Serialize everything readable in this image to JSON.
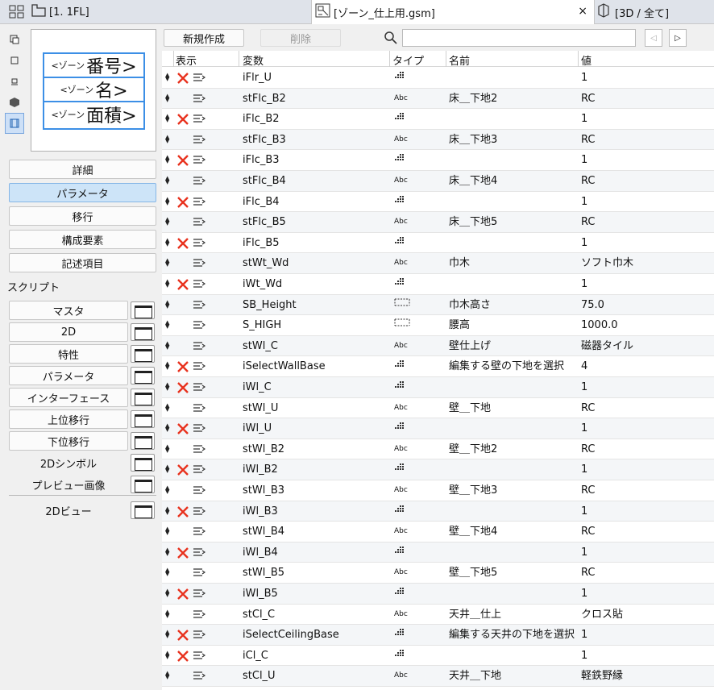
{
  "tabs": {
    "floor_label": "[1. 1FL]",
    "object_label": "[ゾーン_仕上用.gsm]",
    "view3d_label": "[3D / 全て]",
    "close_glyph": "×"
  },
  "preview": {
    "line1_prefix": "<ゾーン",
    "line1_text": "番号>",
    "line2_prefix": "<ゾーン",
    "line2_text": "名>",
    "line3_prefix": "<ゾーン",
    "line3_text": "面積>"
  },
  "nav": [
    "詳細",
    "パラメータ",
    "移行",
    "構成要素",
    "記述項目"
  ],
  "nav_selected": 1,
  "scripts_label": "スクリプト",
  "scripts": [
    "マスタ",
    "2D",
    "特性",
    "パラメータ",
    "インターフェース",
    "上位移行",
    "下位移行",
    "2Dシンボル",
    "プレビュー画像"
  ],
  "view2d_label": "2Dビュー",
  "toolbar": {
    "new_label": "新規作成",
    "delete_label": "削除",
    "search_placeholder": ""
  },
  "columns": {
    "display": "表示",
    "variable": "変数",
    "type": "タイプ",
    "name": "名前",
    "value": "値"
  },
  "rows": [
    {
      "hidden": true,
      "var": "iFlr_U",
      "type": "int",
      "name": "",
      "value": "1"
    },
    {
      "hidden": false,
      "var": "stFlc_B2",
      "type": "abc",
      "name": "床＿下地2",
      "value": "RC"
    },
    {
      "hidden": true,
      "var": "iFlc_B2",
      "type": "int",
      "name": "",
      "value": "1"
    },
    {
      "hidden": false,
      "var": "stFlc_B3",
      "type": "abc",
      "name": "床＿下地3",
      "value": "RC"
    },
    {
      "hidden": true,
      "var": "iFlc_B3",
      "type": "int",
      "name": "",
      "value": "1"
    },
    {
      "hidden": false,
      "var": "stFlc_B4",
      "type": "abc",
      "name": "床＿下地4",
      "value": "RC"
    },
    {
      "hidden": true,
      "var": "iFlc_B4",
      "type": "int",
      "name": "",
      "value": "1"
    },
    {
      "hidden": false,
      "var": "stFlc_B5",
      "type": "abc",
      "name": "床＿下地5",
      "value": "RC"
    },
    {
      "hidden": true,
      "var": "iFlc_B5",
      "type": "int",
      "name": "",
      "value": "1"
    },
    {
      "hidden": false,
      "var": "stWt_Wd",
      "type": "abc",
      "name": "巾木",
      "value": "ソフト巾木"
    },
    {
      "hidden": true,
      "var": "iWt_Wd",
      "type": "int",
      "name": "",
      "value": "1"
    },
    {
      "hidden": false,
      "var": "SB_Height",
      "type": "len",
      "name": "巾木高さ",
      "value": "75.0"
    },
    {
      "hidden": false,
      "var": "S_HIGH",
      "type": "len",
      "name": "腰高",
      "value": "1000.0"
    },
    {
      "hidden": false,
      "var": "stWl_C",
      "type": "abc",
      "name": "壁仕上げ",
      "value": "磁器タイル"
    },
    {
      "hidden": true,
      "var": "iSelectWallBase",
      "type": "int",
      "name": "編集する壁の下地を選択",
      "value": "4"
    },
    {
      "hidden": true,
      "var": "iWl_C",
      "type": "int",
      "name": "",
      "value": "1"
    },
    {
      "hidden": false,
      "var": "stWl_U",
      "type": "abc",
      "name": "壁＿下地",
      "value": "RC"
    },
    {
      "hidden": true,
      "var": "iWl_U",
      "type": "int",
      "name": "",
      "value": "1"
    },
    {
      "hidden": false,
      "var": "stWl_B2",
      "type": "abc",
      "name": "壁＿下地2",
      "value": "RC"
    },
    {
      "hidden": true,
      "var": "iWl_B2",
      "type": "int",
      "name": "",
      "value": "1"
    },
    {
      "hidden": false,
      "var": "stWl_B3",
      "type": "abc",
      "name": "壁＿下地3",
      "value": "RC"
    },
    {
      "hidden": true,
      "var": "iWl_B3",
      "type": "int",
      "name": "",
      "value": "1"
    },
    {
      "hidden": false,
      "var": "stWl_B4",
      "type": "abc",
      "name": "壁＿下地4",
      "value": "RC"
    },
    {
      "hidden": true,
      "var": "iWl_B4",
      "type": "int",
      "name": "",
      "value": "1"
    },
    {
      "hidden": false,
      "var": "stWl_B5",
      "type": "abc",
      "name": "壁＿下地5",
      "value": "RC"
    },
    {
      "hidden": true,
      "var": "iWl_B5",
      "type": "int",
      "name": "",
      "value": "1"
    },
    {
      "hidden": false,
      "var": "stCl_C",
      "type": "abc",
      "name": "天井＿仕上",
      "value": "クロス貼"
    },
    {
      "hidden": true,
      "var": "iSelectCeilingBase",
      "type": "int",
      "name": "編集する天井の下地を選択",
      "value": "1"
    },
    {
      "hidden": true,
      "var": "iCl_C",
      "type": "int",
      "name": "",
      "value": "1"
    },
    {
      "hidden": false,
      "var": "stCl_U",
      "type": "abc",
      "name": "天井＿下地",
      "value": "軽鉄野縁"
    }
  ],
  "type_text": {
    "abc": "Abc"
  },
  "colors": {
    "hidden_x": "#e8321e",
    "accent": "#3c8fe6"
  }
}
